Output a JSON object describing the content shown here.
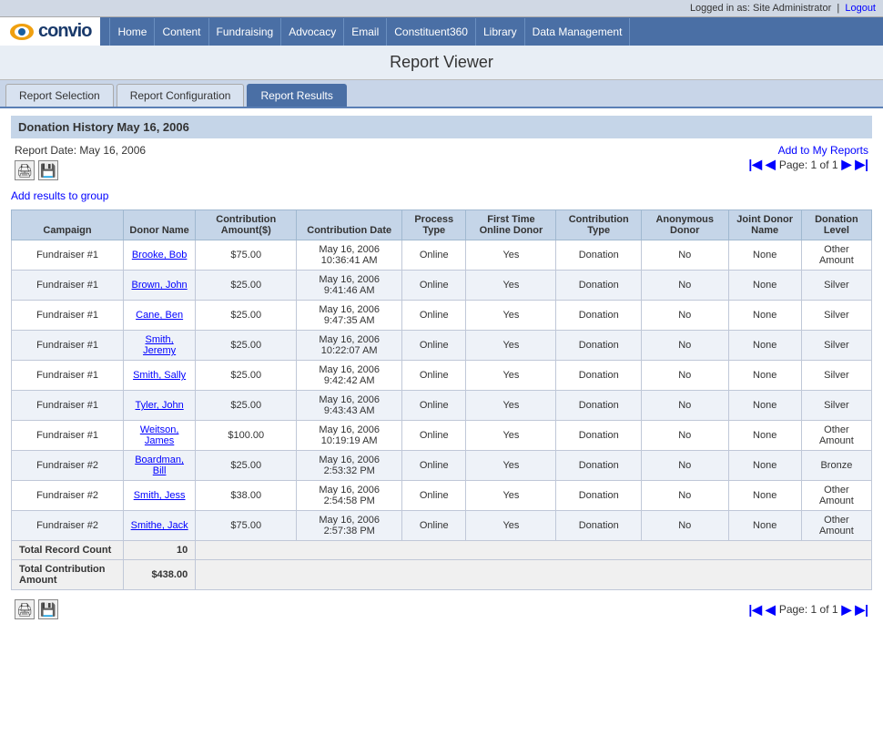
{
  "topbar": {
    "logged_in_text": "Logged in as: Site Administrator",
    "logout_label": "Logout"
  },
  "nav": {
    "logo_text": "convio",
    "links": [
      {
        "label": "Home"
      },
      {
        "label": "Content"
      },
      {
        "label": "Fundraising"
      },
      {
        "label": "Advocacy"
      },
      {
        "label": "Email"
      },
      {
        "label": "Constituent360"
      },
      {
        "label": "Library"
      },
      {
        "label": "Data Management"
      }
    ]
  },
  "page_title": "Report Viewer",
  "tabs": [
    {
      "label": "Report Selection",
      "active": false
    },
    {
      "label": "Report Configuration",
      "active": false
    },
    {
      "label": "Report Results",
      "active": true
    }
  ],
  "report": {
    "title": "Donation History May 16, 2006",
    "date_label": "Report Date: May 16, 2006",
    "add_to_reports": "Add to My Reports",
    "pagination_text": "Page: 1 of 1",
    "add_group_label": "Add results to group",
    "print_icon": "🖨",
    "save_icon": "💾",
    "columns": [
      "Campaign",
      "Donor Name",
      "Contribution Amount($)",
      "Contribution Date",
      "Process Type",
      "First Time Online Donor",
      "Contribution Type",
      "Anonymous Donor",
      "Joint Donor Name",
      "Donation Level"
    ],
    "rows": [
      {
        "campaign": "Fundraiser #1",
        "donor_name": "Brooke, Bob",
        "amount": "$75.00",
        "date": "May 16, 2006 10:36:41 AM",
        "process_type": "Online",
        "first_time": "Yes",
        "contribution_type": "Donation",
        "anonymous": "No",
        "joint_donor": "None",
        "level": "Other Amount"
      },
      {
        "campaign": "Fundraiser #1",
        "donor_name": "Brown, John",
        "amount": "$25.00",
        "date": "May 16, 2006 9:41:46 AM",
        "process_type": "Online",
        "first_time": "Yes",
        "contribution_type": "Donation",
        "anonymous": "No",
        "joint_donor": "None",
        "level": "Silver"
      },
      {
        "campaign": "Fundraiser #1",
        "donor_name": "Cane, Ben",
        "amount": "$25.00",
        "date": "May 16, 2006 9:47:35 AM",
        "process_type": "Online",
        "first_time": "Yes",
        "contribution_type": "Donation",
        "anonymous": "No",
        "joint_donor": "None",
        "level": "Silver"
      },
      {
        "campaign": "Fundraiser #1",
        "donor_name": "Smith, Jeremy",
        "amount": "$25.00",
        "date": "May 16, 2006 10:22:07 AM",
        "process_type": "Online",
        "first_time": "Yes",
        "contribution_type": "Donation",
        "anonymous": "No",
        "joint_donor": "None",
        "level": "Silver"
      },
      {
        "campaign": "Fundraiser #1",
        "donor_name": "Smith, Sally",
        "amount": "$25.00",
        "date": "May 16, 2006 9:42:42 AM",
        "process_type": "Online",
        "first_time": "Yes",
        "contribution_type": "Donation",
        "anonymous": "No",
        "joint_donor": "None",
        "level": "Silver"
      },
      {
        "campaign": "Fundraiser #1",
        "donor_name": "Tyler, John",
        "amount": "$25.00",
        "date": "May 16, 2006 9:43:43 AM",
        "process_type": "Online",
        "first_time": "Yes",
        "contribution_type": "Donation",
        "anonymous": "No",
        "joint_donor": "None",
        "level": "Silver"
      },
      {
        "campaign": "Fundraiser #1",
        "donor_name": "Weitson, James",
        "amount": "$100.00",
        "date": "May 16, 2006 10:19:19 AM",
        "process_type": "Online",
        "first_time": "Yes",
        "contribution_type": "Donation",
        "anonymous": "No",
        "joint_donor": "None",
        "level": "Other Amount"
      },
      {
        "campaign": "Fundraiser #2",
        "donor_name": "Boardman, Bill",
        "amount": "$25.00",
        "date": "May 16, 2006 2:53:32 PM",
        "process_type": "Online",
        "first_time": "Yes",
        "contribution_type": "Donation",
        "anonymous": "No",
        "joint_donor": "None",
        "level": "Bronze"
      },
      {
        "campaign": "Fundraiser #2",
        "donor_name": "Smith, Jess",
        "amount": "$38.00",
        "date": "May 16, 2006 2:54:58 PM",
        "process_type": "Online",
        "first_time": "Yes",
        "contribution_type": "Donation",
        "anonymous": "No",
        "joint_donor": "None",
        "level": "Other Amount"
      },
      {
        "campaign": "Fundraiser #2",
        "donor_name": "Smithe, Jack",
        "amount": "$75.00",
        "date": "May 16, 2006 2:57:38 PM",
        "process_type": "Online",
        "first_time": "Yes",
        "contribution_type": "Donation",
        "anonymous": "No",
        "joint_donor": "None",
        "level": "Other Amount"
      }
    ],
    "total_record_count_label": "Total Record Count",
    "total_record_count_value": "10",
    "total_contribution_label": "Total Contribution Amount",
    "total_contribution_value": "$438.00"
  }
}
